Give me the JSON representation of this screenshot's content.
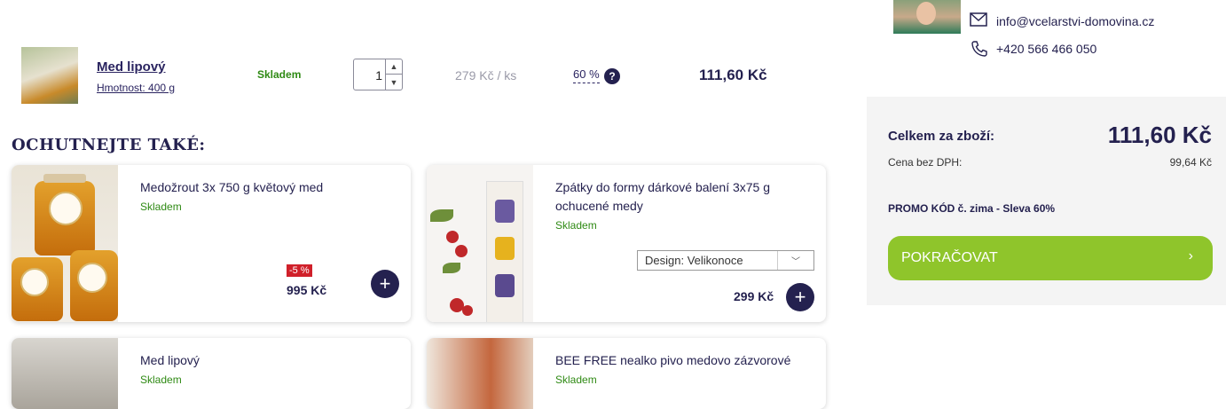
{
  "cart_item": {
    "name": "Med lipový",
    "weight": "Hmotnost: 400 g",
    "stock": "Skladem",
    "quantity": "1",
    "unit_price": "279 Kč",
    "unit_suffix": "/ ks",
    "discount": "60 %",
    "help": "?",
    "total": "111,60 Kč"
  },
  "recommend": {
    "title": "OCHUTNEJTE TAKÉ:",
    "items": [
      {
        "title": "Medožrout 3x 750 g květový med",
        "stock": "Skladem",
        "badge": "-5 %",
        "price": "995 Kč"
      },
      {
        "title": "Zpátky do formy dárkové balení 3x75 g ochucené medy",
        "stock": "Skladem",
        "design": "Design: Velikonoce",
        "price": "299 Kč"
      },
      {
        "title": "Med lipový",
        "stock": "Skladem"
      },
      {
        "title": "BEE FREE nealko pivo medovo zázvorové",
        "stock": "Skladem"
      }
    ],
    "add_label": "+"
  },
  "contact": {
    "email": "info@vcelarstvi-domovina.cz",
    "phone": "+420 566 466 050"
  },
  "summary": {
    "label": "Celkem za zboží:",
    "total": "111,60 Kč",
    "vat_label": "Cena bez DPH:",
    "vat_value": "99,64 Kč",
    "promo": "PROMO KÓD č. zima - Sleva 60%",
    "continue_label": "POKRAČOVAT",
    "continue_arrow": "›"
  },
  "colors": {
    "brand_navy": "#24214f",
    "stock_green": "#2f8a14",
    "cta_green": "#8fc52b",
    "sale_red": "#d0202a"
  }
}
